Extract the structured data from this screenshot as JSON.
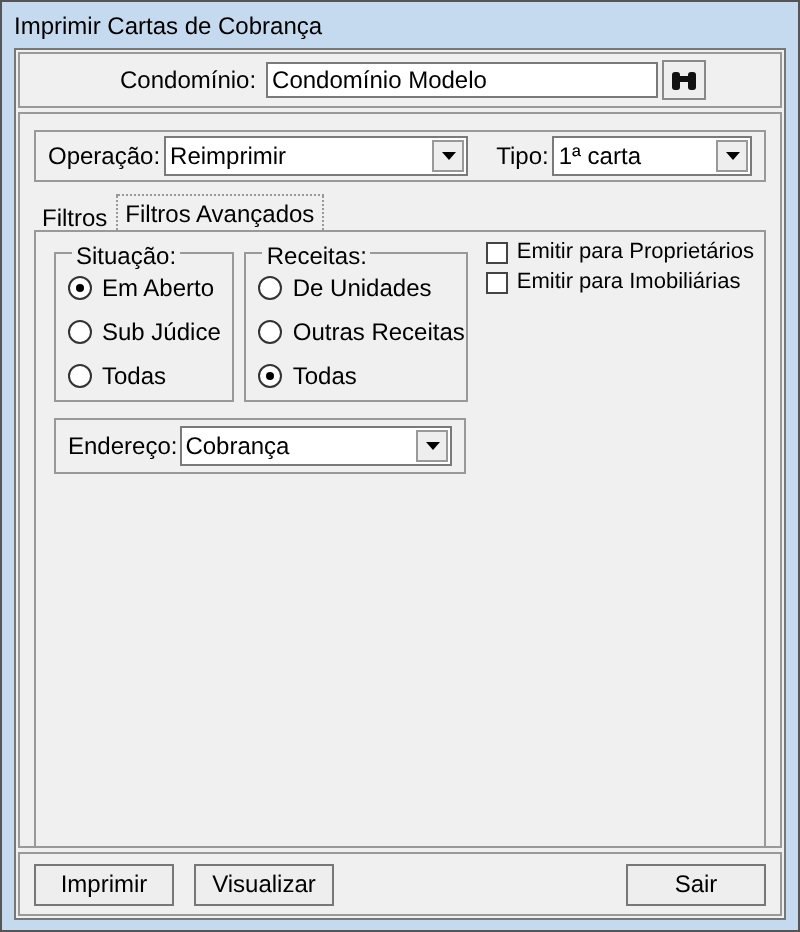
{
  "window": {
    "title": "Imprimir Cartas de Cobrança"
  },
  "condominio": {
    "label": "Condomínio:",
    "value": "Condomínio Modelo"
  },
  "operacao": {
    "label": "Operação:",
    "value": "Reimprimir"
  },
  "tipo": {
    "label": "Tipo:",
    "value": "1ª carta"
  },
  "tabs": [
    {
      "label": "Filtros",
      "selected": false
    },
    {
      "label": "Filtros Avançados",
      "selected": true
    }
  ],
  "situacao": {
    "title": "Situação:",
    "options": [
      {
        "label": "Em Aberto",
        "selected": true
      },
      {
        "label": "Sub Júdice",
        "selected": false
      },
      {
        "label": "Todas",
        "selected": false
      }
    ]
  },
  "receitas": {
    "title": "Receitas:",
    "options": [
      {
        "label": "De Unidades",
        "selected": false
      },
      {
        "label": "Outras Receitas",
        "selected": false
      },
      {
        "label": "Todas",
        "selected": true
      }
    ]
  },
  "checkboxes": [
    {
      "label": "Emitir para Proprietários",
      "checked": false
    },
    {
      "label": "Emitir para Imobiliárias",
      "checked": false
    }
  ],
  "endereco": {
    "label": "Endereço:",
    "value": "Cobrança"
  },
  "buttons": [
    {
      "label": "Imprimir"
    },
    {
      "label": "Visualizar"
    },
    {
      "label": "Sair"
    }
  ]
}
